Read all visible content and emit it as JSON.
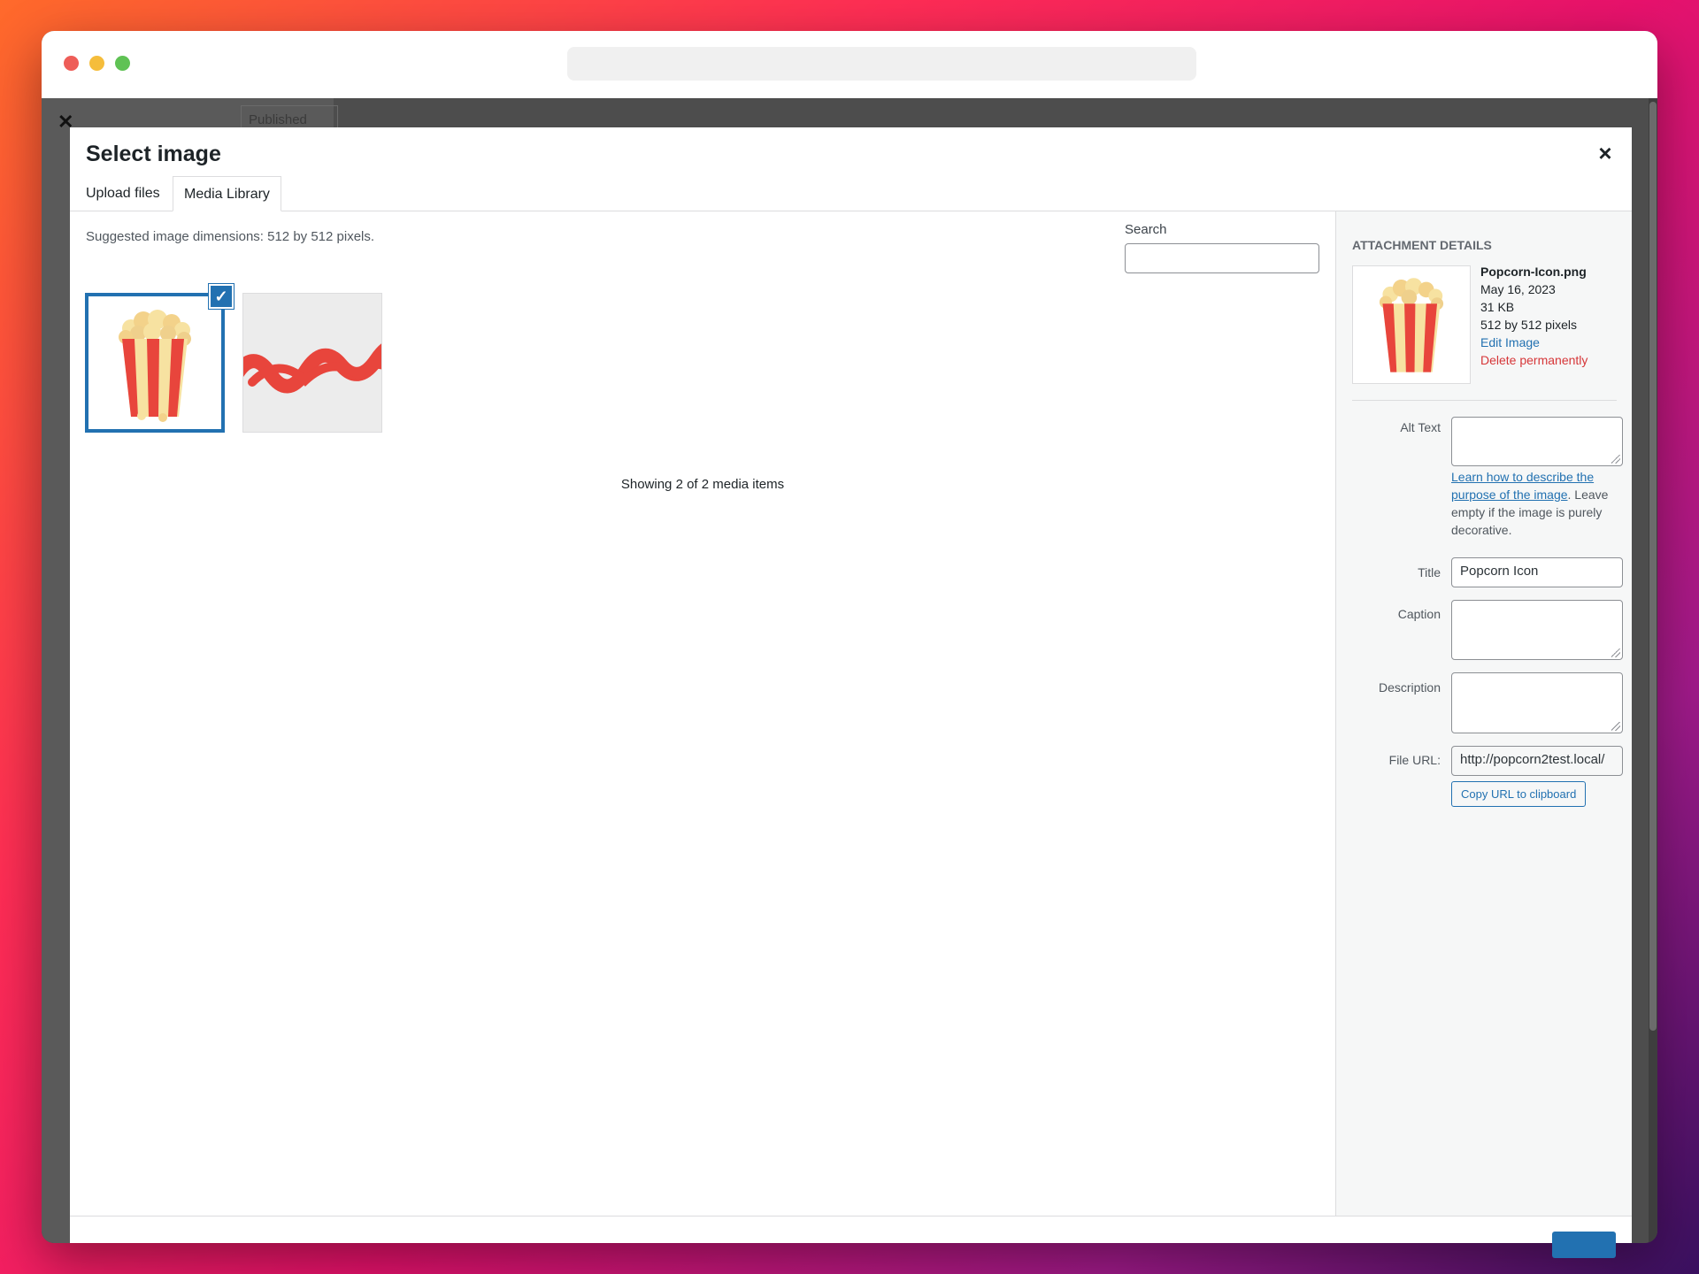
{
  "modal": {
    "title": "Select image",
    "close_icon": "close-icon"
  },
  "tabs": [
    {
      "label": "Upload files"
    },
    {
      "label": "Media Library"
    }
  ],
  "background": {
    "close_glyph": "✕",
    "published_label": "Published"
  },
  "library": {
    "suggested": "Suggested image dimensions: 512 by 512 pixels.",
    "search_label": "Search",
    "search_value": "",
    "showing": "Showing 2 of 2 media items",
    "items": [
      {
        "name": "popcorn-icon",
        "selected": true
      },
      {
        "name": "popcorn-logo",
        "selected": false
      }
    ],
    "check_glyph": "✓"
  },
  "attachment": {
    "heading": "Attachment Details",
    "filename": "Popcorn-Icon.png",
    "date": "May 16, 2023",
    "size": "31 KB",
    "dimensions": "512 by 512 pixels",
    "edit_label": "Edit Image",
    "delete_label": "Delete permanently"
  },
  "fields": {
    "alt_text_label": "Alt Text",
    "alt_text_value": "",
    "help_link": "Learn how to describe the purpose of the image",
    "help_rest": ". Leave empty if the image is purely decorative.",
    "title_label": "Title",
    "title_value": "Popcorn Icon",
    "caption_label": "Caption",
    "caption_value": "",
    "description_label": "Description",
    "description_value": "",
    "file_url_label": "File URL:",
    "file_url_value": "http://popcorn2test.local/",
    "copy_label": "Copy URL to clipboard"
  },
  "colors": {
    "accent": "#2271b1",
    "danger": "#d63638",
    "popcorn_red": "#e8453c",
    "popcorn_cream": "#f7e2a1"
  }
}
